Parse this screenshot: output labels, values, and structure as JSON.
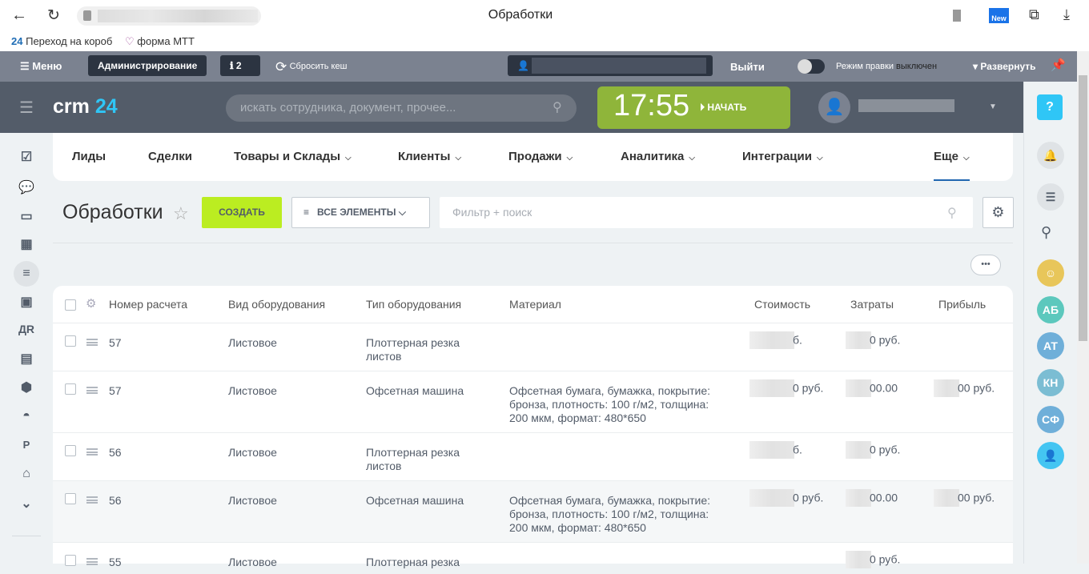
{
  "browser": {
    "title": "Обработки",
    "bookmarks": [
      {
        "icon": "24",
        "label": "Переход на короб"
      },
      {
        "label": "форма МТТ"
      }
    ],
    "new_badge": "New"
  },
  "admin_bar": {
    "menu": "Меню",
    "admin": "Администрирование",
    "notifications": "2",
    "reset_cache": "Сбросить кеш",
    "logout": "Выйти",
    "edit_mode_label": "Режим правки",
    "edit_mode_state": "выключен",
    "expand": "Развернуть"
  },
  "header": {
    "logo_main": "crm",
    "logo_num": "24",
    "search_placeholder": "искать сотрудника, документ, прочее...",
    "time": "17:55",
    "start": "НАЧАТЬ"
  },
  "nav": [
    "Лиды",
    "Сделки",
    "Товары и Склады",
    "Клиенты",
    "Продажи",
    "Аналитика",
    "Интеграции",
    "Еще"
  ],
  "left_sidebar": {
    "text_icons": [
      "ДR",
      "P"
    ]
  },
  "page": {
    "title": "Обработки",
    "create": "СОЗДАТЬ",
    "filter_preset": "ВСЕ ЭЛЕМЕНТЫ",
    "filter_placeholder": "Фильтр + поиск",
    "more": "•••"
  },
  "table": {
    "columns": [
      "Номер расчета",
      "Вид оборудования",
      "Тип оборудования",
      "Материал",
      "Стоимость",
      "Затраты",
      "Прибыль"
    ],
    "rows": [
      {
        "num": "57",
        "kind": "Листовое",
        "type": "Плоттерная резка листов",
        "material": "",
        "cost": "б.",
        "expenses": "0 руб.",
        "profit": ""
      },
      {
        "num": "57",
        "kind": "Листовое",
        "type": "Офсетная машина",
        "material": "Офсетная бумага, бумажка, покрытие: бронза, плотность: 100 г/м2, толщина: 200 мкм, формат: 480*650",
        "cost": "0 руб.",
        "expenses": "00.00",
        "profit": "00 руб."
      },
      {
        "num": "56",
        "kind": "Листовое",
        "type": "Плоттерная резка листов",
        "material": "",
        "cost": "б.",
        "expenses": "0 руб.",
        "profit": ""
      },
      {
        "num": "56",
        "kind": "Листовое",
        "type": "Офсетная машина",
        "material": "Офсетная бумага, бумажка, покрытие: бронза, плотность: 100 г/м2, толщина: 200 мкм, формат: 480*650",
        "cost": "0 руб.",
        "expenses": "00.00",
        "profit": "00 руб."
      },
      {
        "num": "55",
        "kind": "Листовое",
        "type": "Плоттерная резка",
        "material": "",
        "cost": "",
        "expenses": "0 руб.",
        "profit": ""
      }
    ]
  },
  "right_sidebar": {
    "avatars": [
      {
        "initials": "АБ",
        "color": "#5cc8bd"
      },
      {
        "initials": "АТ",
        "color": "#6fafd9"
      },
      {
        "initials": "КН",
        "color": "#7bbdd3"
      },
      {
        "initials": "СФ",
        "color": "#6fafd9"
      }
    ]
  }
}
